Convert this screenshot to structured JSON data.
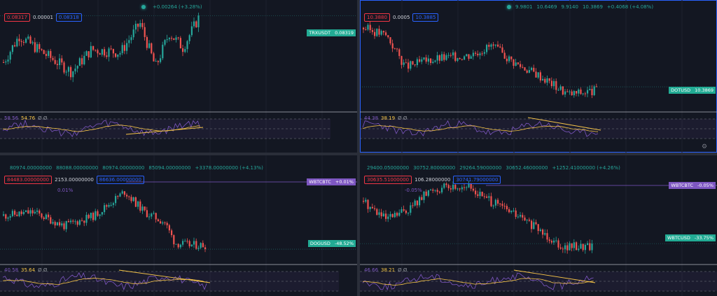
{
  "colors": {
    "up": "#26a69a",
    "down": "#ef5350",
    "rsi": "#7e57c2",
    "ma": "#f7c548",
    "accent": "#2962ff"
  },
  "panels": [
    {
      "header_ohlc": [
        "+0.00264 (+3.28%)"
      ],
      "bid": "0.08317",
      "spread": "0.00001",
      "ask": "0.08318",
      "symbol_tag": {
        "name": "TRXUSDT",
        "value": "0.08319"
      },
      "indicator": {
        "v1": "58.56",
        "v2": "54.76",
        "v3": "Ø",
        "v4": "Ø"
      }
    },
    {
      "header_ohlc": [
        "9.9801",
        "10.6469",
        "9.9140",
        "10.3869",
        "+0.4068 (+4.08%)"
      ],
      "bid": "10.3880",
      "spread": "0.0005",
      "ask": "10.3885",
      "symbol_tag": {
        "name": "DOTUSD",
        "value": "10.3869"
      },
      "indicator": {
        "v1": "44.38",
        "v2": "38.19",
        "v3": "Ø",
        "v4": "Ø"
      },
      "settings_icon": "gear-icon"
    },
    {
      "header_ohlc": [
        "80974.00000000",
        "88088.00000000",
        "80974.00000000",
        "85094.00000000",
        "+3378.00000000 (+4.13%)"
      ],
      "bid": "84483.00000000",
      "spread": "2153.00000000",
      "ask": "86636.00000000",
      "compare_pct": "0.01%",
      "compare_tag": {
        "name": "WBTCBTC",
        "value": "+0.01%"
      },
      "symbol_tag": {
        "name": "DOGUSD",
        "value": "-48.52%"
      },
      "indicator": {
        "v1": "40.58",
        "v2": "35.64",
        "v3": "Ø",
        "v4": "Ø"
      }
    },
    {
      "header_ohlc": [
        "29400.05000000",
        "30752.80000000",
        "29264.59000000",
        "30652.46000000",
        "+1252.41000000 (+4.26%)"
      ],
      "bid": "30635.51000000",
      "spread": "106.28000000",
      "ask": "30741.79000000",
      "compare_pct": "-0.05%",
      "compare_tag": {
        "name": "WBTCBTC",
        "value": "-0.05%"
      },
      "symbol_tag": {
        "name": "WBTCUSD",
        "value": "-33.75%"
      },
      "indicator": {
        "v1": "46.66",
        "v2": "38.21",
        "v3": "Ø",
        "v4": "Ø"
      }
    }
  ]
}
